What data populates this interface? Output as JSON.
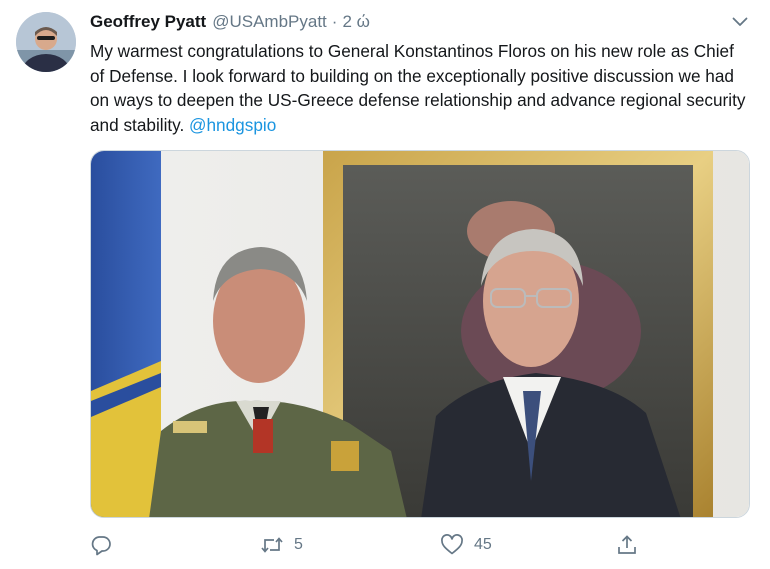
{
  "tweet": {
    "author_name": "Geoffrey Pyatt",
    "author_handle": "@USAmbPyatt",
    "separator": "·",
    "time": "2 ώ",
    "text_part1": "My warmest congratulations to General Konstantinos Floros on his new role as Chief of Defense. I look forward to building on the exceptionally positive discussion we had on ways to deepen the US-Greece defense relationship and advance regional security and stability. ",
    "mention": "@hndgspio"
  },
  "actions": {
    "reply_icon": "reply-icon",
    "retweet_icon": "retweet-icon",
    "retweet_count": "5",
    "like_icon": "heart-icon",
    "like_count": "45",
    "share_icon": "share-icon"
  },
  "colors": {
    "text": "#14171a",
    "secondary": "#657786",
    "link": "#1b95e0"
  }
}
